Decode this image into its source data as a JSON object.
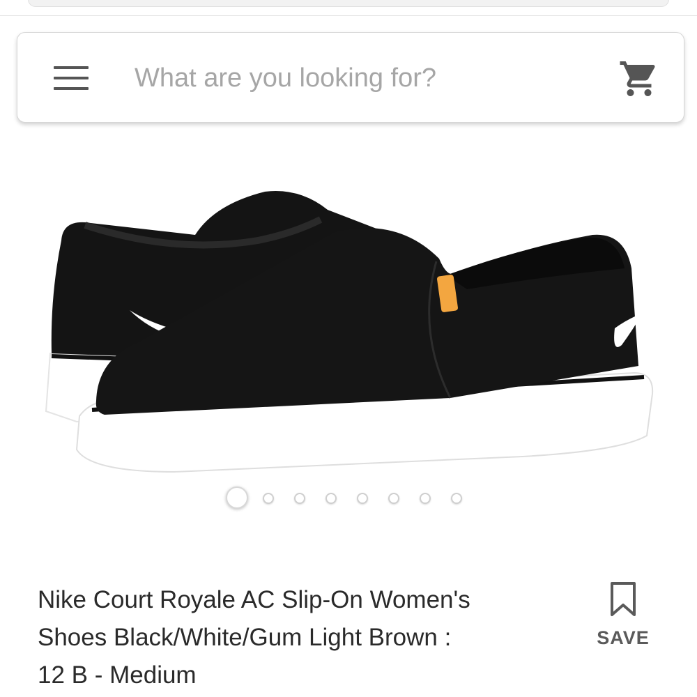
{
  "search": {
    "placeholder": "What are you looking for?"
  },
  "icons": {
    "menu": "hamburger-menu-icon",
    "cart": "shopping-cart-icon",
    "save": "bookmark-icon"
  },
  "product": {
    "title_lines": [
      "Nike Court Royale AC Slip-On Women's",
      "Shoes Black/White/Gum Light Brown :",
      "12 B - Medium"
    ],
    "image_count": 8,
    "active_image_index": 0
  },
  "save": {
    "label": "SAVE"
  },
  "colors": {
    "icon_gray": "#555555",
    "placeholder_gray": "#a6a6a6",
    "shoe_black": "#111111",
    "sole_white": "#ffffff",
    "tab_orange": "#f3a640"
  }
}
